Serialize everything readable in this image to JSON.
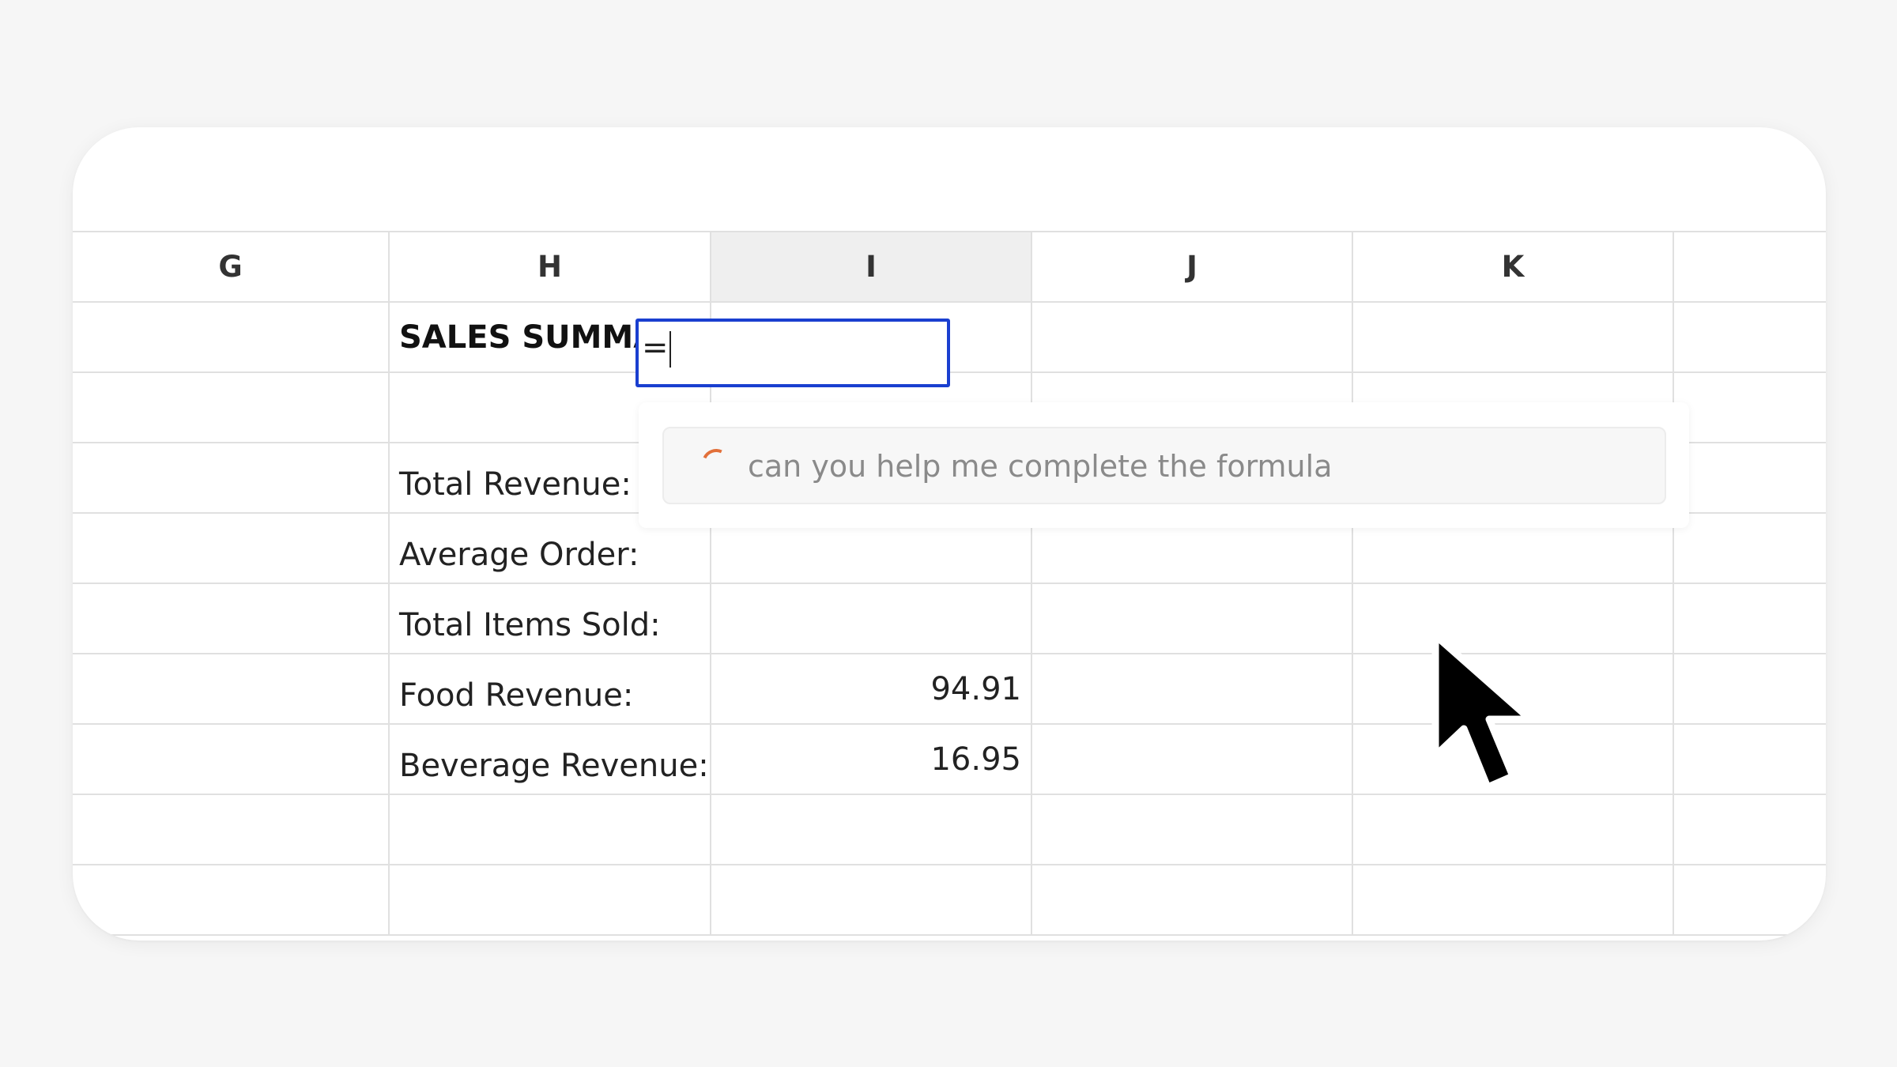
{
  "columns": [
    "G",
    "H",
    "I",
    "J",
    "K",
    ""
  ],
  "active_column": "I",
  "rows": [
    {
      "h": "SALES SUMMARY",
      "i": ""
    },
    {
      "h": "",
      "i": ""
    },
    {
      "h": "Total Revenue:",
      "i": ""
    },
    {
      "h": "Average Order:",
      "i": ""
    },
    {
      "h": "Total Items Sold:",
      "i": ""
    },
    {
      "h": "Food Revenue:",
      "i": "94.91"
    },
    {
      "h": "Beverage Revenue:",
      "i": "16.95"
    },
    {
      "h": "",
      "i": ""
    },
    {
      "h": "",
      "i": ""
    }
  ],
  "editor": {
    "value": "="
  },
  "ai_prompt": {
    "text": "can you help me complete the formula",
    "spinner_icon": "loading-spinner-icon",
    "spinner_color": "#e2703a"
  },
  "colors": {
    "editor_border": "#1a3fd0",
    "active_column_bg": "#efefef"
  }
}
